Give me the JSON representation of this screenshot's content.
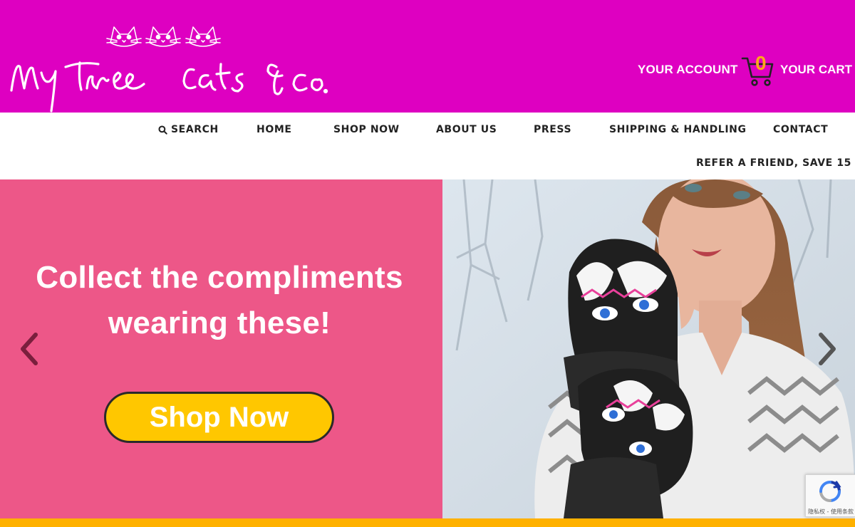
{
  "header": {
    "logo_text": "My three cats & Co.",
    "account_label": "YOUR ACCOUNT",
    "cart_count": "0",
    "cart_label": "YOUR CART"
  },
  "nav": {
    "search_label": "SEARCH",
    "items": [
      "HOME",
      "SHOP NOW",
      "ABOUT US",
      "PRESS",
      "SHIPPING & HANDLING",
      "CONTACT",
      "REFER A FRIEND, SAVE 15"
    ]
  },
  "hero": {
    "headline_line1": "Collect the compliments",
    "headline_line2": "wearing these!",
    "cta_label": "Shop Now"
  },
  "recaptcha": {
    "footer_text": "隐私权 - 使用条款"
  },
  "colors": {
    "header_bg": "#de00c1",
    "hero_left_bg": "#ed5788",
    "cta_bg": "#ffc700",
    "cart_count": "#ffa61a",
    "bottom_strip": "#ffb100"
  },
  "icons": [
    "search-icon",
    "cart-icon",
    "chevron-left-icon",
    "chevron-right-icon",
    "recaptcha-icon",
    "cat-face-icon"
  ]
}
